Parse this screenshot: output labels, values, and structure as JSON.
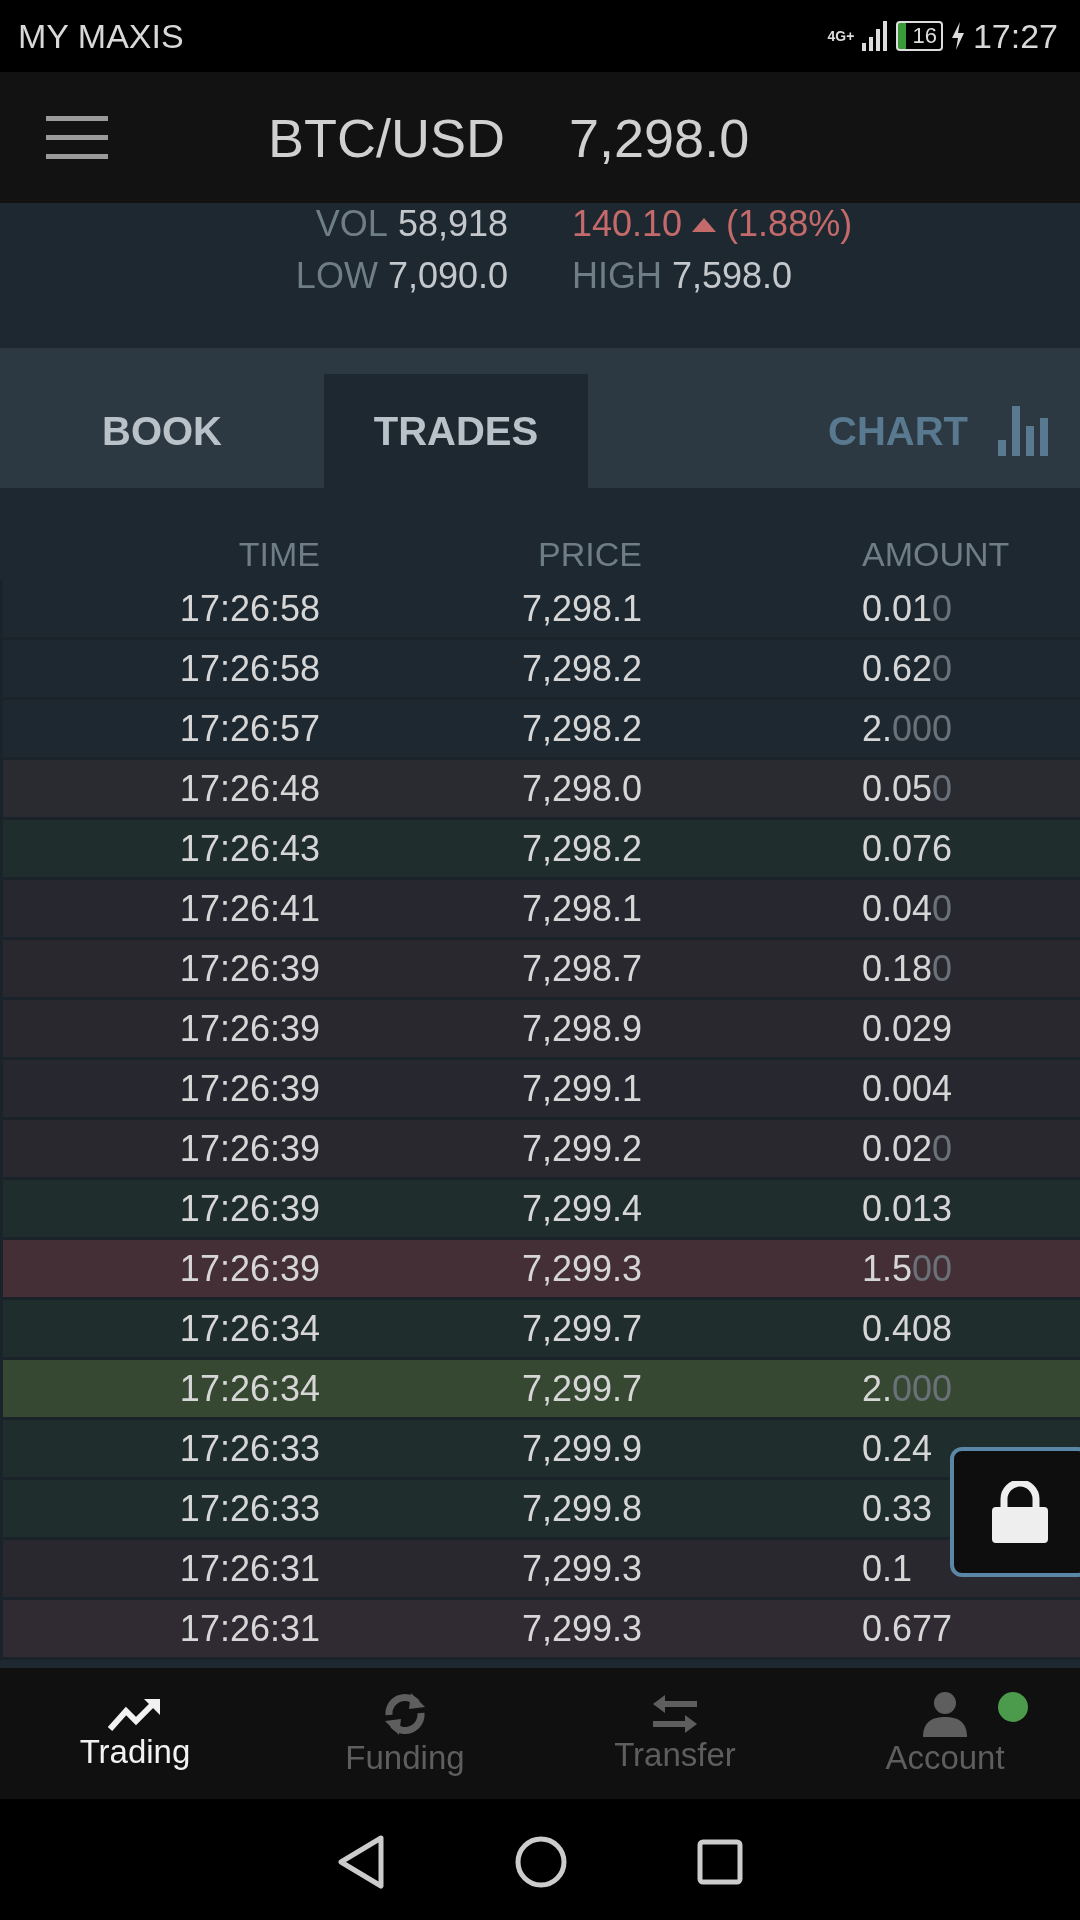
{
  "status_bar": {
    "carrier": "MY MAXIS",
    "network": "4G+",
    "battery": "16",
    "time": "17:27"
  },
  "header": {
    "pair": "BTC/USD",
    "price": "7,298.0"
  },
  "stats": {
    "vol_label": "VOL",
    "vol": "58,918",
    "change": "140.10",
    "change_pct": "(1.88%)",
    "low_label": "LOW",
    "low": "7,090.0",
    "high_label": "HIGH",
    "high": "7,598.0"
  },
  "tabs": [
    {
      "label": "BOOK",
      "selected": false,
      "kind": "text"
    },
    {
      "label": "TRADES",
      "selected": true,
      "kind": "text"
    },
    {
      "label": "CHART",
      "selected": false,
      "kind": "chart"
    }
  ],
  "table": {
    "columns": [
      "TIME",
      "PRICE",
      "AMOUNT"
    ],
    "rows": [
      {
        "time": "17:26:58",
        "price": "7,298.1",
        "amount": "0.01",
        "amount_zeros": "0",
        "color": "#1d2830"
      },
      {
        "time": "17:26:58",
        "price": "7,298.2",
        "amount": "0.62",
        "amount_zeros": "0",
        "color": "#1d2830"
      },
      {
        "time": "17:26:57",
        "price": "7,298.2",
        "amount": "2.",
        "amount_zeros": "000",
        "color": "#1d2830"
      },
      {
        "time": "17:26:48",
        "price": "7,298.0",
        "amount": "0.05",
        "amount_zeros": "0",
        "color": "#2a2a31"
      },
      {
        "time": "17:26:43",
        "price": "7,298.2",
        "amount": "0.076",
        "color": "#1f2d2c"
      },
      {
        "time": "17:26:41",
        "price": "7,298.1",
        "amount": "0.04",
        "amount_zeros": "0",
        "color": "#27272f"
      },
      {
        "time": "17:26:39",
        "price": "7,298.7",
        "amount": "0.18",
        "amount_zeros": "0",
        "color": "#29282f"
      },
      {
        "time": "17:26:39",
        "price": "7,298.9",
        "amount": "0.029",
        "color": "#29282f"
      },
      {
        "time": "17:26:39",
        "price": "7,299.1",
        "amount": "0.004",
        "color": "#27272f"
      },
      {
        "time": "17:26:39",
        "price": "7,299.2",
        "amount": "0.02",
        "amount_zeros": "0",
        "color": "#29282f"
      },
      {
        "time": "17:26:39",
        "price": "7,299.4",
        "amount": "0.013",
        "color": "#1f2d2c"
      },
      {
        "time": "17:26:39",
        "price": "7,299.3",
        "amount": "1.5",
        "amount_zeros": "00",
        "color": "#452f36"
      },
      {
        "time": "17:26:34",
        "price": "7,299.7",
        "amount": "0.408",
        "color": "#1f2d2c"
      },
      {
        "time": "17:26:34",
        "price": "7,299.7",
        "amount": "2.",
        "amount_zeros": "000",
        "color": "#364832"
      },
      {
        "time": "17:26:33",
        "price": "7,299.9",
        "amount": "0.24",
        "color": "#1f2d2c"
      },
      {
        "time": "17:26:33",
        "price": "7,299.8",
        "amount": "0.33",
        "color": "#1f2d2c"
      },
      {
        "time": "17:26:31",
        "price": "7,299.3",
        "amount": "0.1",
        "color": "#29282f"
      },
      {
        "time": "17:26:31",
        "price": "7,299.3",
        "amount": "0.677",
        "color": "#302a33"
      }
    ]
  },
  "bottom_nav": [
    {
      "label": "Trading",
      "kind": "trend",
      "selected": true,
      "online": false
    },
    {
      "label": "Funding",
      "kind": "refresh",
      "selected": false,
      "online": false
    },
    {
      "label": "Transfer",
      "kind": "transfer",
      "selected": false,
      "online": false
    },
    {
      "label": "Account",
      "kind": "person",
      "selected": false,
      "online": true
    }
  ]
}
